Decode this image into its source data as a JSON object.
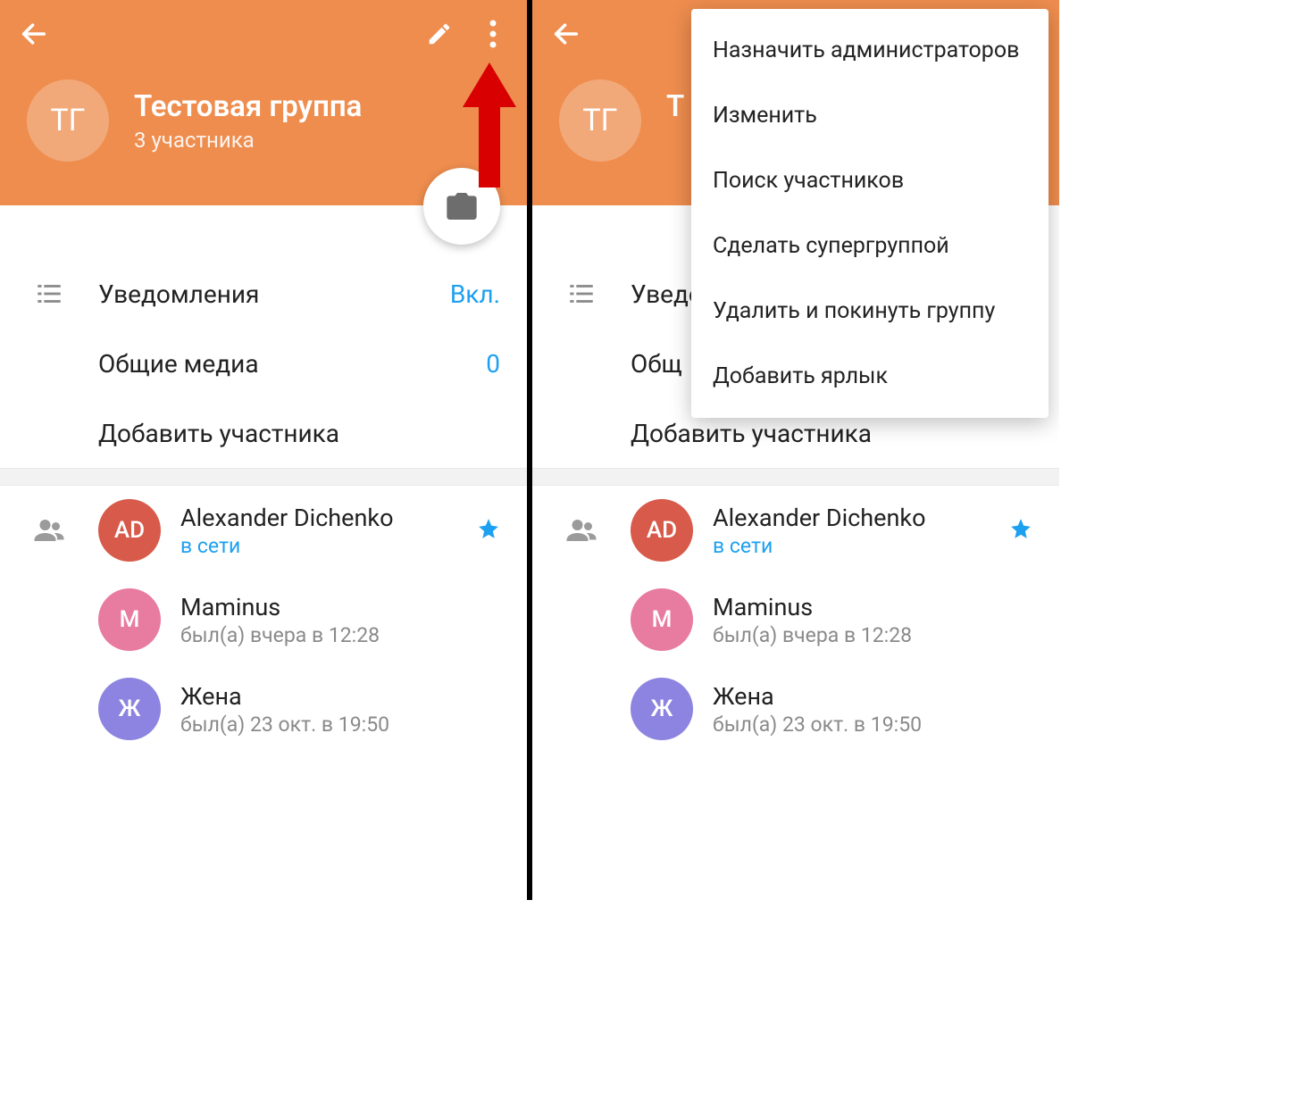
{
  "group": {
    "avatar_initials": "ТГ",
    "title": "Тестовая группа",
    "subtitle": "3 участника"
  },
  "rows": {
    "notifications_label": "Уведомления",
    "notifications_value": "Вкл.",
    "media_label": "Общие медиа",
    "media_value": "0",
    "add_member_label": "Добавить участника"
  },
  "members": [
    {
      "initials": "AD",
      "name": "Alexander Dichenko",
      "status": "в сети",
      "online": true,
      "starred": true,
      "avatar_color": "#d75a4a"
    },
    {
      "initials": "M",
      "name": "Maminus",
      "status": "был(а) вчера в 12:28",
      "online": false,
      "starred": false,
      "avatar_color": "#e87ba0"
    },
    {
      "initials": "Ж",
      "name": "Жена",
      "status": "был(а) 23 окт. в 19:50",
      "online": false,
      "starred": false,
      "avatar_color": "#8c84e0"
    }
  ],
  "menu": [
    "Назначить администраторов",
    "Изменить",
    "Поиск участников",
    "Сделать супергруппой",
    "Удалить и покинуть группу",
    "Добавить ярлык"
  ],
  "pane2_media_label_visible": "Общ",
  "pane2_group_title_visible": "Т"
}
